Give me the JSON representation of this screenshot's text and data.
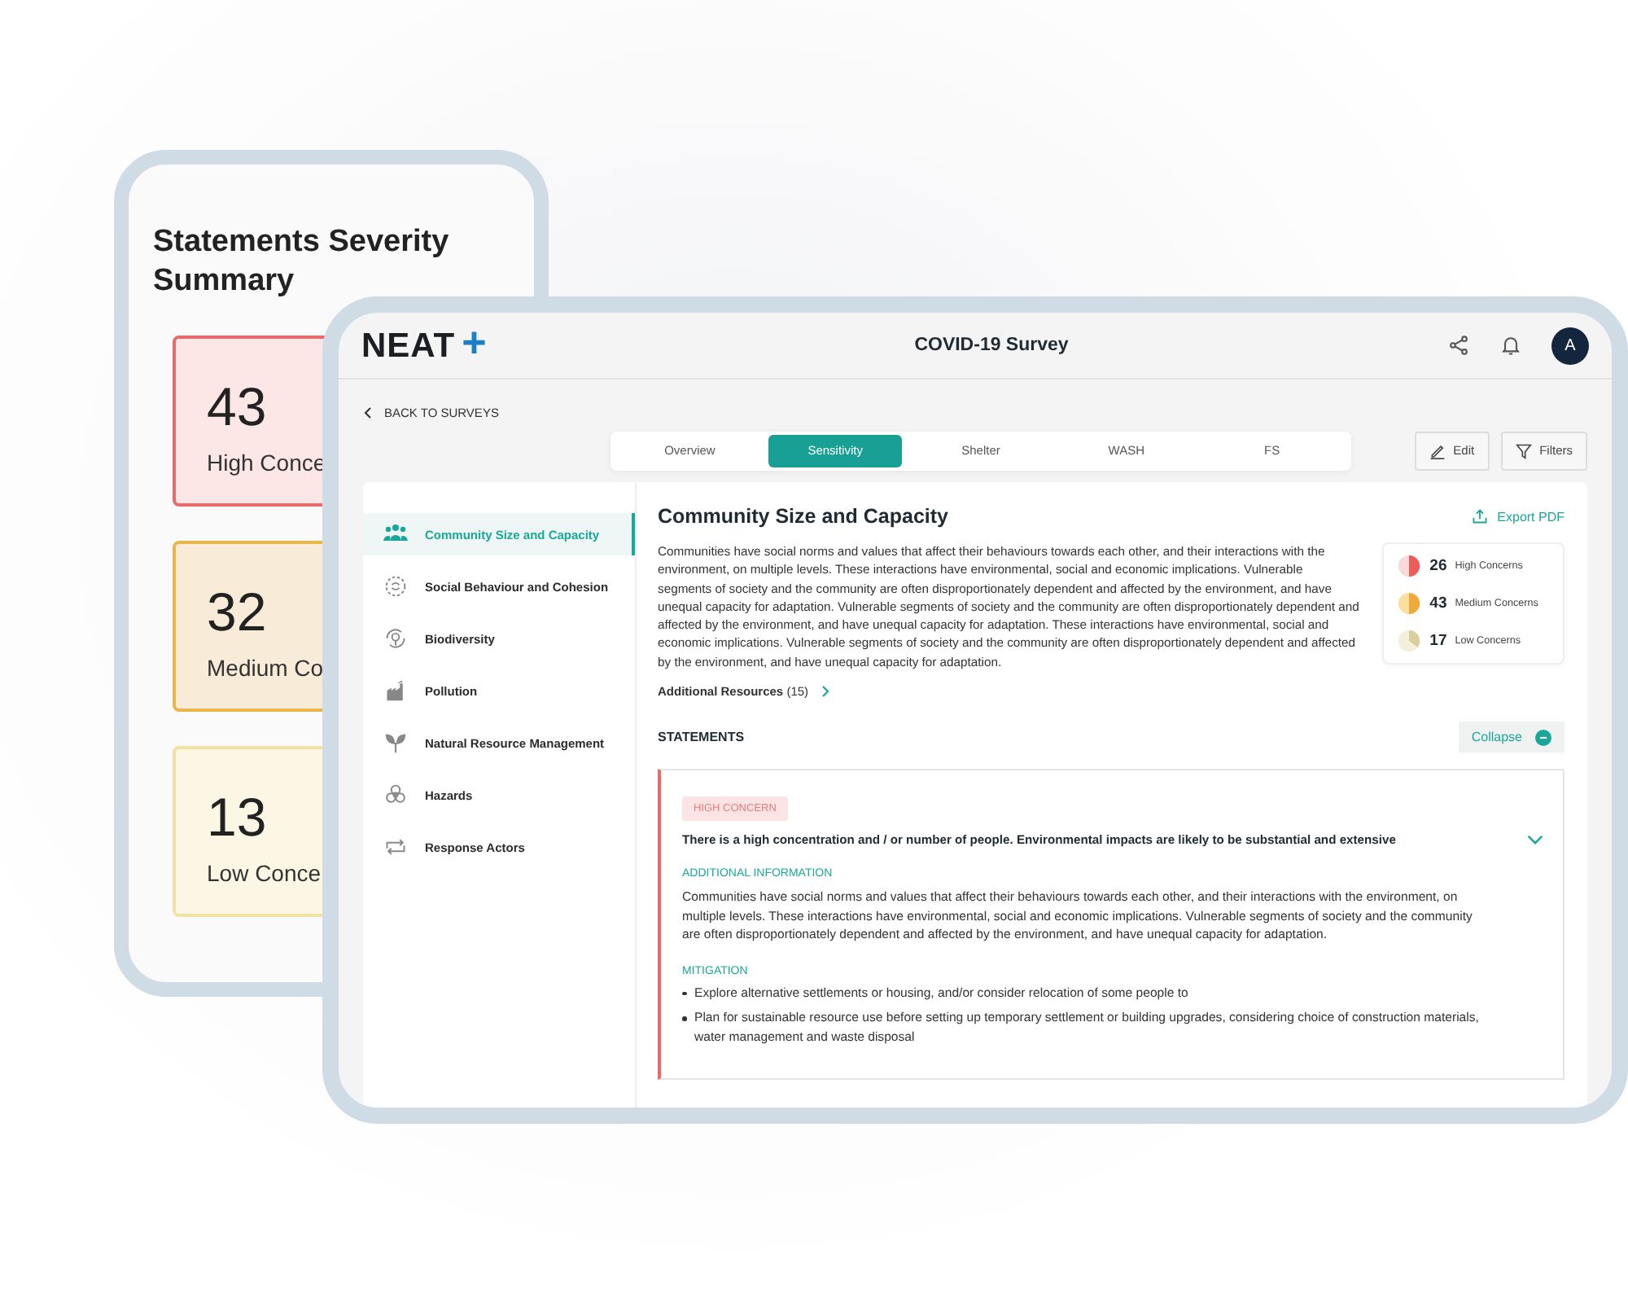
{
  "summary_card": {
    "title": "Statements Severity Summary",
    "items": [
      {
        "kind": "high",
        "count": "43",
        "label": "High Conce"
      },
      {
        "kind": "medium",
        "count": "32",
        "label": "Medium Co"
      },
      {
        "kind": "low",
        "count": "13",
        "label": "Low Conce"
      }
    ]
  },
  "app": {
    "logo": {
      "text": "NEAT",
      "mark": "+"
    },
    "title": "COVID-19 Survey",
    "avatar": "A",
    "back_link": "BACK TO SURVEYS",
    "tabs": [
      {
        "label": "Overview",
        "selected": false
      },
      {
        "label": "Sensitivity",
        "selected": true
      },
      {
        "label": "Shelter",
        "selected": false
      },
      {
        "label": "WASH",
        "selected": false
      },
      {
        "label": "FS",
        "selected": false
      }
    ],
    "actions": [
      {
        "kind": "edit",
        "label": "Edit"
      },
      {
        "kind": "filter",
        "label": "Filters"
      }
    ],
    "sidebar": {
      "items": [
        {
          "label": "Community Size and Capacity",
          "selected": true
        },
        {
          "label": "Social Behaviour and Cohesion",
          "selected": false
        },
        {
          "label": "Biodiversity",
          "selected": false
        },
        {
          "label": "Pollution",
          "selected": false
        },
        {
          "label": "Natural Resource Management",
          "selected": false
        },
        {
          "label": "Hazards",
          "selected": false
        },
        {
          "label": "Response Actors",
          "selected": false
        }
      ]
    }
  },
  "section": {
    "title": "Community Size and Capacity",
    "export": "Export PDF",
    "description": "Communities have social norms and values that affect their behaviours towards each other, and their interactions with the environment, on multiple levels. These interactions have environmental, social and economic implications. Vulnerable segments of society and the community are often disproportionately dependent and affected by the environment, and have unequal capacity for adaptation. Vulnerable segments of society and the community are often disproportionately dependent and affected by the environment, and have unequal capacity for adaptation. These interactions have environmental, social and economic implications. Vulnerable segments of society and the community are often disproportionately dependent and affected by the environment, and have unequal capacity for adaptation.",
    "additional_resources": "**Additional Resources** (15)",
    "concerns": [
      {
        "kind": "high",
        "count": "26",
        "label": "High Concerns"
      },
      {
        "kind": "medium",
        "count": "43",
        "label": "Medium Concerns"
      },
      {
        "kind": "low",
        "count": "17",
        "label": "Low Concerns"
      }
    ]
  },
  "statements": {
    "heading": "STATEMENTS",
    "collapse": "Collapse",
    "items": [
      {
        "kind": "high",
        "badge": "HIGH CONCERN",
        "text": "There is a high concentration and / or number of people. Environmental impacts are likely to be substantial and extensive",
        "expanded": true,
        "sections": [
          {
            "kind": "text",
            "heading": "ADDITIONAL INFORMATION",
            "body": "Communities have social norms and values that affect their behaviours towards each other, and their interactions with the environment, on multiple levels. These interactions have environmental, social and economic implications. Vulnerable segments of society and the community are often disproportionately dependent and affected by the environment, and have unequal capacity for adaptation."
          },
          {
            "kind": "bullets",
            "heading": "MITIGATION",
            "items": [
              "Explore alternative settlements or housing, and/or consider relocation of some people to",
              "Plan for sustainable resource use before setting up temporary settlement or building upgrades, considering choice of construction materials, water management and waste disposal"
            ]
          }
        ]
      }
    ]
  }
}
